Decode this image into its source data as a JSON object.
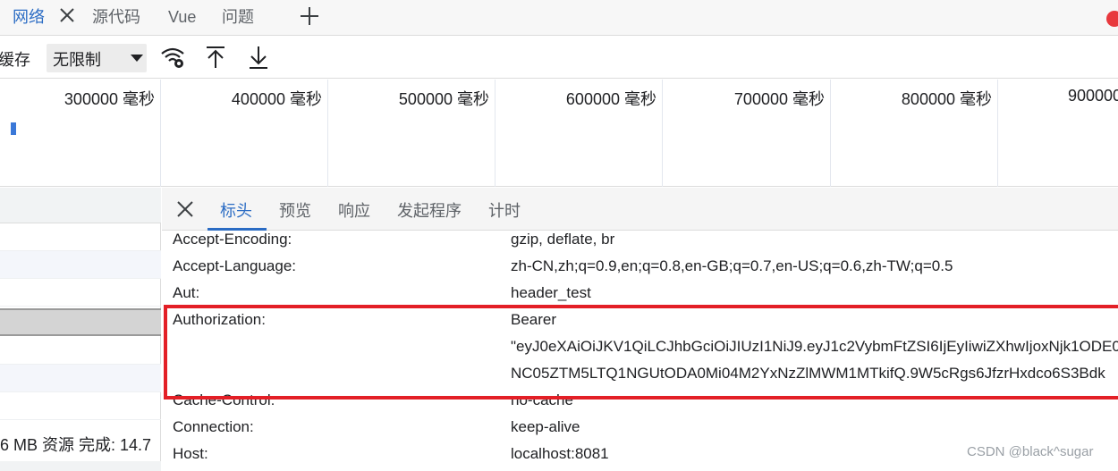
{
  "tabs": [
    {
      "label": "网络"
    },
    {
      "label": "源代码"
    },
    {
      "label": "Vue"
    },
    {
      "label": "问题"
    }
  ],
  "toolbar": {
    "cache_label": "缓存",
    "throttle_value": "无限制"
  },
  "timeline": {
    "ticks": [
      "300000 毫秒",
      "400000 毫秒",
      "500000 毫秒",
      "600000 毫秒",
      "700000 毫秒",
      "800000 毫秒",
      "900000"
    ]
  },
  "request_list": {
    "footer_text": "6 MB 资源  完成: 14.7"
  },
  "detail": {
    "tabs": [
      "标头",
      "预览",
      "响应",
      "发起程序",
      "计时"
    ],
    "headers": [
      {
        "name": "Accept-Encoding:",
        "value": "gzip, deflate, br"
      },
      {
        "name": "Accept-Language:",
        "value": "zh-CN,zh;q=0.9,en;q=0.8,en-GB;q=0.7,en-US;q=0.6,zh-TW;q=0.5"
      },
      {
        "name": "Aut:",
        "value": "header_test"
      },
      {
        "name": "Authorization:",
        "value": "Bearer",
        "value_line2": "\"eyJ0eXAiOiJKV1QiLCJhbGciOiJIUzI1NiJ9.eyJ1c2VybmFtZSI6IjEyIiwiZXhwIjoxNjk1ODE0",
        "value_line3": "NC05ZTM5LTQ1NGUtODA0Mi04M2YxNzZlMWM1MTkifQ.9W5cRgs6JfzrHxdco6S3Bdk"
      },
      {
        "name": "Cache-Control:",
        "value": "no-cache"
      },
      {
        "name": "Connection:",
        "value": "keep-alive"
      },
      {
        "name": "Host:",
        "value": "localhost:8081"
      }
    ]
  },
  "watermark": "CSDN @black^sugar",
  "colors": {
    "accent": "#2b6cc4",
    "highlight": "#e31f26"
  }
}
